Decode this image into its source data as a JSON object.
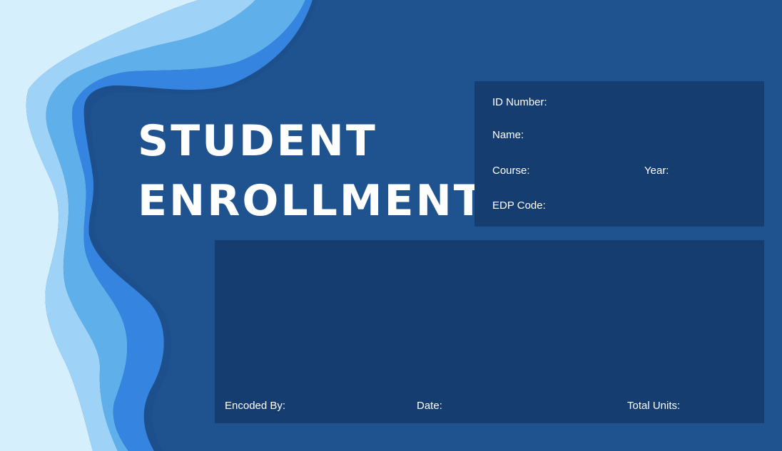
{
  "title": {
    "line1": "STUDENT",
    "line2": "ENROLLMENT"
  },
  "student_info": {
    "id_number": "ID Number:",
    "name": "Name:",
    "course": "Course:",
    "year": "Year:",
    "edp_code": "EDP Code:"
  },
  "footer": {
    "encoded_by": "Encoded By:",
    "date": "Date:",
    "total_units": "Total Units:"
  },
  "colors": {
    "background": "#1f5390",
    "panel": "#153d70",
    "wave_light": "#d6effd",
    "wave_mid": "#9fd2f7",
    "wave_sky": "#5fb0ea",
    "wave_accent": "#3484e0",
    "text": "#ffffff"
  }
}
